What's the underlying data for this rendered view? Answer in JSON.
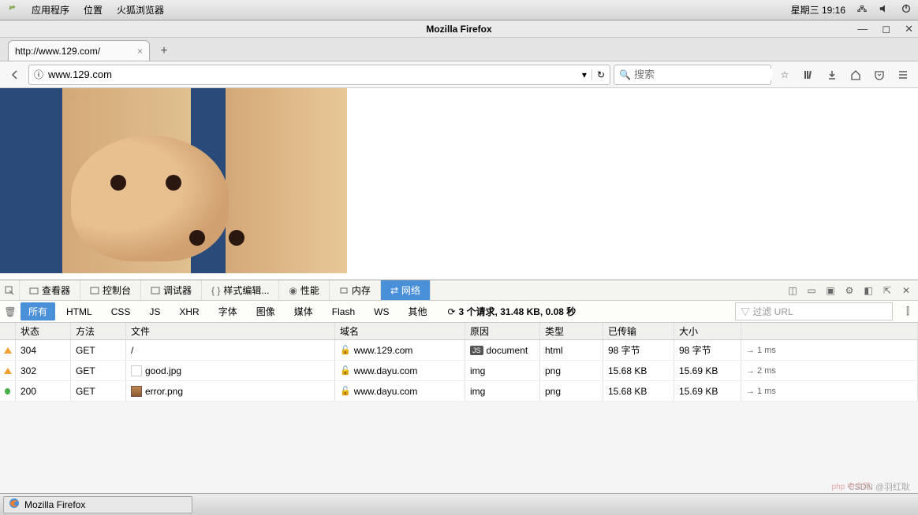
{
  "system": {
    "menus": [
      "应用程序",
      "位置",
      "火狐浏览器"
    ],
    "datetime": "星期三 19:16"
  },
  "window": {
    "title": "Mozilla Firefox"
  },
  "tab": {
    "title": "http://www.129.com/"
  },
  "url": {
    "value": "www.129.com",
    "dropdown_icon": "▾"
  },
  "search": {
    "placeholder": "搜索"
  },
  "devtools": {
    "tabs": {
      "inspector": "查看器",
      "console": "控制台",
      "debugger": "调试器",
      "style": "样式编辑...",
      "performance": "性能",
      "memory": "内存",
      "network": "网络"
    },
    "filters": {
      "all": "所有",
      "html": "HTML",
      "css": "CSS",
      "js": "JS",
      "xhr": "XHR",
      "fonts": "字体",
      "images": "图像",
      "media": "媒体",
      "flash": "Flash",
      "ws": "WS",
      "other": "其他"
    },
    "summary": "3 个请求, 31.48 KB, 0.08 秒",
    "filter_placeholder": "过滤 URL",
    "columns": {
      "status": "状态",
      "method": "方法",
      "file": "文件",
      "domain": "域名",
      "cause": "原因",
      "type": "类型",
      "transferred": "已传输",
      "size": "大小"
    },
    "rows": [
      {
        "ind": "tri",
        "status": "304",
        "method": "GET",
        "file": "/",
        "domain": "www.129.com",
        "cause": "document",
        "causebadge": "JS",
        "type": "html",
        "trans": "98 字节",
        "size": "98 字节",
        "time": "→ 1 ms",
        "ico": ""
      },
      {
        "ind": "tri",
        "status": "302",
        "method": "GET",
        "file": "good.jpg",
        "domain": "www.dayu.com",
        "cause": "img",
        "causebadge": "",
        "type": "png",
        "trans": "15.68 KB",
        "size": "15.69 KB",
        "time": "→ 2 ms",
        "ico": "blank"
      },
      {
        "ind": "dot",
        "status": "200",
        "method": "GET",
        "file": "error.png",
        "domain": "www.dayu.com",
        "cause": "img",
        "causebadge": "",
        "type": "png",
        "trans": "15.68 KB",
        "size": "15.69 KB",
        "time": "→ 1 ms",
        "ico": "img"
      }
    ]
  },
  "taskbar": {
    "app": "Mozilla Firefox"
  },
  "watermark": {
    "csdn": "CSDN @羽红耿",
    "php": "php 中文网"
  }
}
